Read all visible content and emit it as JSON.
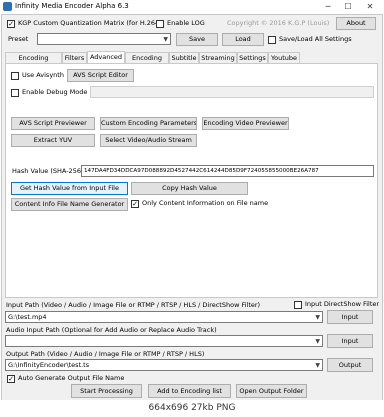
{
  "window": {
    "title": "Infinity Media Encoder Alpha 6.3",
    "minimize": "─",
    "maximize": "☐",
    "close": "✕"
  },
  "top": {
    "kgp_label": "KGP Custom Quantization Matrix (for H.264)",
    "kgp_checked": true,
    "enable_log_label": "Enable LOG",
    "enable_log_checked": false,
    "copyright": "Copyright © 2016 K.G.P (Louis)",
    "about": "About",
    "preset_label": "Preset",
    "preset_value": "",
    "save": "Save",
    "load": "Load",
    "saveload_all_label": "Save/Load All Settings",
    "saveload_all_checked": false
  },
  "tabs": [
    "Encoding Options",
    "Filters",
    "Advanced",
    "Encoding List",
    "Subtitle",
    "Streaming",
    "Settings",
    "Youtube"
  ],
  "active_tab": "Advanced",
  "advanced": {
    "use_avisynth_label": "Use Avisynth",
    "use_avisynth_checked": false,
    "avs_script_editor": "AVS Script Editor",
    "debug_mode_label": "Enable Debug Mode",
    "debug_mode_checked": false,
    "avs_script_previewer": "AVS Script Previewer",
    "custom_encoding_parameters": "Custom Encoding Parameters",
    "encoding_video_previewer": "Encoding Video Previewer",
    "extract_yuv": "Extract YUV",
    "select_video_audio_stream": "Select Video/Audio Stream",
    "hash_label": "Hash Value (SHA-256)",
    "hash_value": "147DA4FD34DDCA97D088892D4527442C614244D85D9F724055855000BE26A787",
    "get_hash": "Get Hash Value from Input File",
    "copy_hash": "Copy Hash Value",
    "content_info_generator": "Content Info File Name Generator",
    "only_content_info_label": "Only Content Information on File name",
    "only_content_info_checked": true
  },
  "io": {
    "input_label": "Input Path (Video / Audio / Image File or RTMP / RTSP / HLS / DirectShow Filter)",
    "input_directshow_label": "Input DirectShow Filter",
    "input_directshow_checked": false,
    "input_value": "G:\\test.mp4",
    "input_button": "Input",
    "audio_label": "Audio Input Path (Optional for Add Audio or Replace Audio Track)",
    "audio_value": "",
    "audio_button": "Input",
    "output_label": "Output Path (Video / Audio / Image File or RTMP / RTSP / HLS)",
    "output_value": "G:\\InfinityEncoder\\test.ts",
    "output_button": "Output",
    "auto_generate_label": "Auto Generate Output File Name",
    "auto_generate_checked": true,
    "start_processing": "Start Processing",
    "add_to_list": "Add to Encoding list",
    "open_output_folder": "Open Output Folder"
  },
  "status": "664x696  27kb  PNG",
  "colors": {
    "accent": "#0078d7",
    "face": "#f0f0f0",
    "button": "#e1e1e1"
  }
}
